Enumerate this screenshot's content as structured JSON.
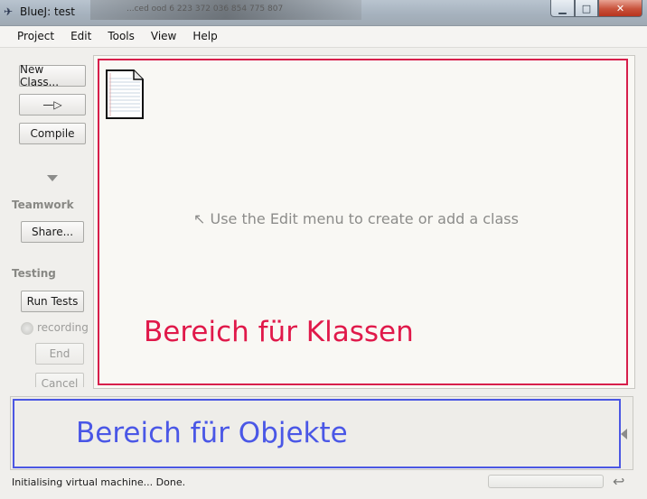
{
  "window": {
    "title": "BlueJ:  test",
    "background_title": "...ced ood 6 223 372 036 854 775 807",
    "app_icon": "bluej-bird-icon",
    "controls": {
      "minimize": "▁",
      "maximize": "□",
      "close": "✕"
    }
  },
  "menu": {
    "items": [
      "Project",
      "Edit",
      "Tools",
      "View",
      "Help"
    ]
  },
  "sidebar": {
    "new_class": "New Class...",
    "arrow_glyph": "—▷",
    "compile": "Compile",
    "teamwork_label": "Teamwork",
    "share": "Share...",
    "testing_label": "Testing",
    "run_tests": "Run Tests",
    "recording": "recording",
    "end": "End",
    "cancel": "Cancel"
  },
  "class_area": {
    "hint": "↖ Use the Edit menu to create or add a class",
    "overlay_label": "Bereich für Klassen",
    "outline_color": "#d71f4b"
  },
  "object_bench": {
    "overlay_label": "Bereich für Objekte",
    "outline_color": "#4b57e3"
  },
  "status": {
    "message": "Initialising virtual machine... Done."
  }
}
